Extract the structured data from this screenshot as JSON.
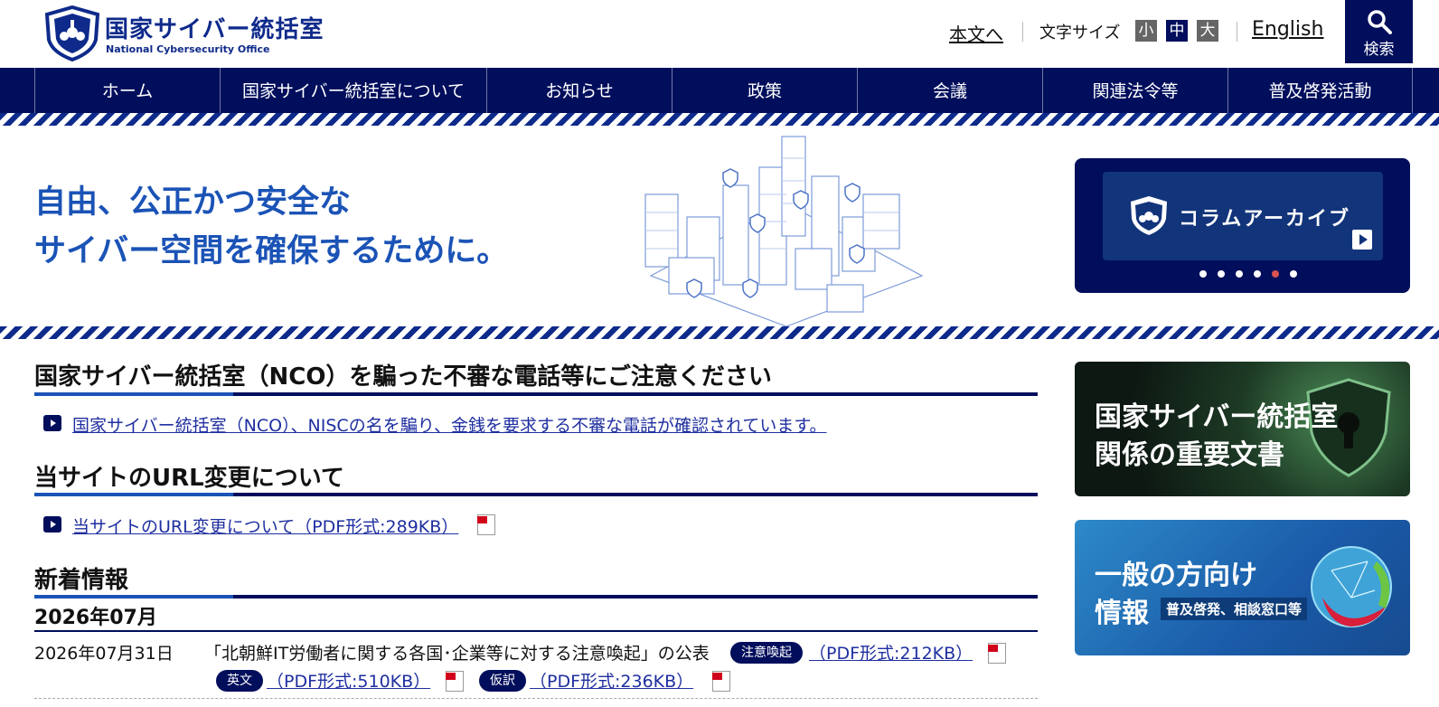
{
  "header": {
    "logo_jp": "国家サイバー統括室",
    "logo_en": "National Cybersecurity Office",
    "skip_link": "本文へ",
    "font_size_label": "文字サイズ",
    "font_sizes": [
      "小",
      "中",
      "大"
    ],
    "english_link": "English",
    "search_label": "検索"
  },
  "nav": {
    "items": [
      "ホーム",
      "国家サイバー統括室について",
      "お知らせ",
      "政策",
      "会議",
      "関連法令等",
      "普及啓発活動"
    ]
  },
  "hero": {
    "tagline_line1": "自由、公正かつ安全な",
    "tagline_line2": "サイバー空間を確保するために。",
    "column_banner": "コラムアーカイブ",
    "carousel_active_index": 5,
    "carousel_count": 6
  },
  "sections": {
    "warning": {
      "title": "国家サイバー統括室（NCO）を騙った不審な電話等にご注意ください",
      "link": "国家サイバー統括室（NCO）、NISCの名を騙り、金銭を要求する不審な電話が確認されています。"
    },
    "url_change": {
      "title": "当サイトのURL変更について",
      "link": "当サイトのURL変更について（PDF形式:289KB）"
    },
    "news": {
      "title": "新着情報",
      "month": "2026年07月",
      "items": [
        {
          "date": "2026年07月31日",
          "title": "「北朝鮮IT労働者に関する各国･企業等に対する注意喚起」の公表",
          "badge_main": "注意喚起",
          "pdf_main": "（PDF形式:212KB）",
          "badge_en": "英文",
          "pdf_en": "（PDF形式:510KB）",
          "badge_trans": "仮訳",
          "pdf_trans": "（PDF形式:236KB）"
        }
      ]
    }
  },
  "sidebar": {
    "banner1_line1": "国家サイバー統括室",
    "banner1_line2": "関係の重要文書",
    "banner2_line1": "一般の方向け",
    "banner2_line2": "情報",
    "banner2_sub": "普及啓発、相談窓口等"
  },
  "colors": {
    "navy": "#000e5c",
    "blue": "#1b53b6",
    "link": "#1f2fa0",
    "active_dot": "#d9534f"
  }
}
